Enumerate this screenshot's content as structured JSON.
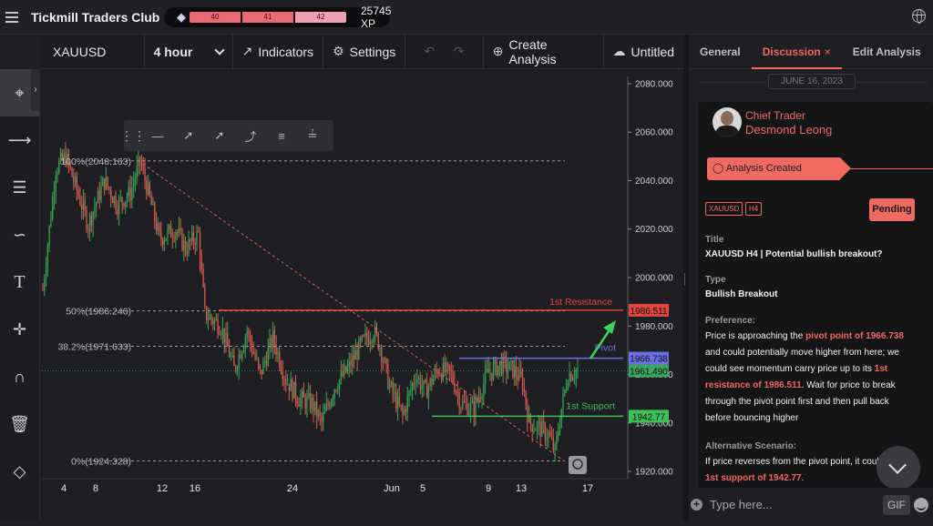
{
  "header": {
    "app_title": "Tickmill Traders Club",
    "xp_bar_segments": [
      "40",
      "41",
      "42"
    ],
    "xp_value": "25745 XP",
    "icons": [
      "menu-icon",
      "rank-badge-icon",
      "globe-icon"
    ]
  },
  "toolbar": {
    "symbol": "XAUUSD",
    "interval": "4 hour",
    "indicators_label": "Indicators",
    "settings_label": "Settings",
    "create_analysis_label": "Create Analysis",
    "untitled_label": "Untitled"
  },
  "left_tools": [
    "crosshair-icon",
    "horizontal-line-icon",
    "fib-retracement-icon",
    "brush-icon",
    "text-icon",
    "pattern-icon",
    "magnet-icon",
    "trash-icon",
    "layers-icon"
  ],
  "chart_data": {
    "type": "candlestick",
    "symbol": "XAUUSD",
    "interval": "4 hour",
    "y_axis": {
      "range": [
        1917,
        2083
      ],
      "ticks": [
        "2080.000",
        "2060.000",
        "2040.000",
        "2020.000",
        "2000.000",
        "1980.000",
        "1960.000",
        "1940.000",
        "1920.000"
      ]
    },
    "x_axis": {
      "ticks": [
        "4",
        "8",
        "12",
        "16",
        "24",
        "Jun",
        "5",
        "9",
        "13",
        "17"
      ]
    },
    "fib_levels": [
      {
        "label": "100%(2048.163)",
        "value": 2048.163
      },
      {
        "label": "50%(1986.246)",
        "value": 1986.246
      },
      {
        "label": "38.2%(1971.633)",
        "value": 1971.633
      },
      {
        "label": "0%(1924.328)",
        "value": 1924.328
      }
    ],
    "levels": [
      {
        "name": "1st Resistance",
        "value": 1986.511,
        "value_label": "1986.511",
        "color": "#e0453f"
      },
      {
        "name": "Pivot",
        "value": 1966.738,
        "value_label": "1966.738",
        "color": "#6b70e6"
      },
      {
        "name": "1st Support",
        "value": 1942.77,
        "value_label": "1942.77",
        "color": "#3fbf5a"
      }
    ],
    "last_price": {
      "value": 1961.49,
      "label": "1961.490"
    },
    "colors": {
      "up": "#3aa55b",
      "down": "#e05a52"
    }
  },
  "side_panel": {
    "tabs": [
      {
        "label": "General"
      },
      {
        "label": "Discussion",
        "active": true,
        "close": "×"
      },
      {
        "label": "Edit Analysis"
      }
    ],
    "date": "JUNE 16, 2023",
    "author_role": "Chief Trader",
    "author_name": "Desmond Leong",
    "banner": "Analysis Created",
    "chips": [
      "XAUUSD",
      "H4"
    ],
    "status": "Pending",
    "title_label": "Title",
    "title_value": "XAUUSD H4 | Potential bullish breakout?",
    "type_label": "Type",
    "type_value": "Bullish Breakout",
    "preference_label": "Preference:",
    "pref_t1": "Price is approaching the ",
    "pref_h1": "pivot point of 1966.738",
    "pref_t2": " and could potentially move higher from here; we could see momentum carry price up to its ",
    "pref_h2": "1st resistance of 1986.511",
    "pref_t3": ". Wait for price to break through the pivot point first and then pull back before bouncing higher",
    "alt_label": "Alternative Scenario:",
    "alt_t1": "If price reverses from the pivot point, it could hit the ",
    "alt_h1": "1st support of 1942.77",
    "alt_t2": ".",
    "composer_placeholder": "Type here...",
    "gif_label": "GIF"
  }
}
